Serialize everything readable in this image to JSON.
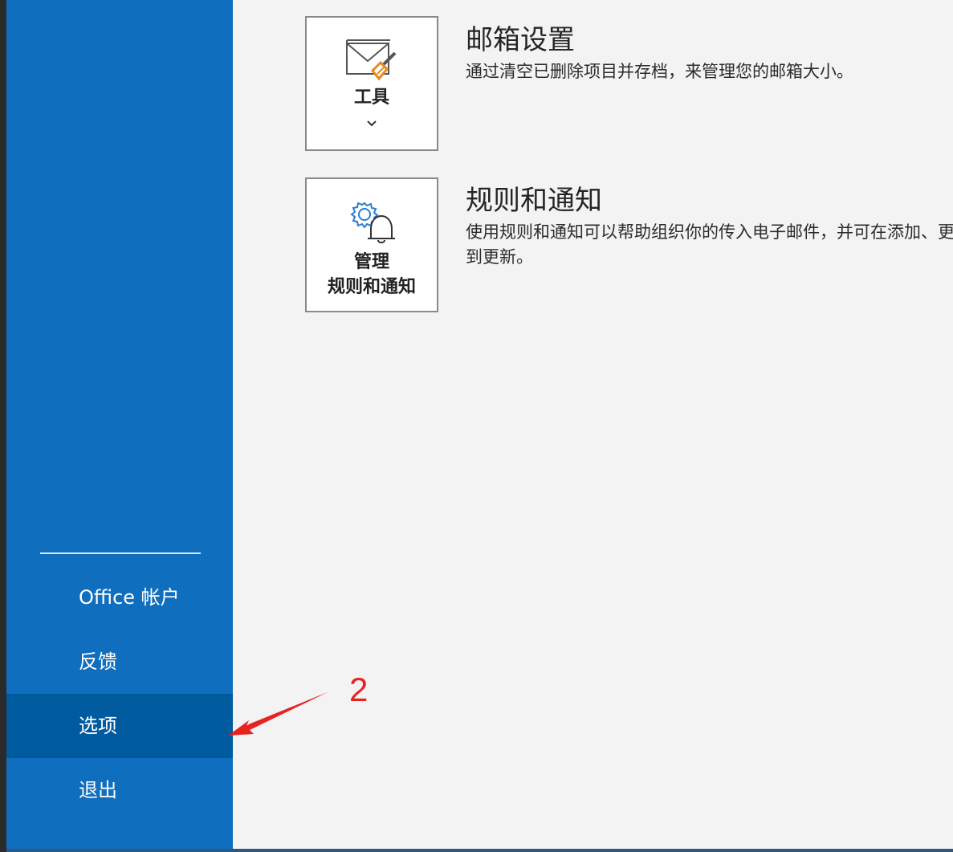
{
  "sidebar": {
    "items": [
      {
        "label": "Office 帐户"
      },
      {
        "label": "反馈"
      },
      {
        "label": "选项"
      },
      {
        "label": "退出"
      }
    ],
    "selected_index": 2
  },
  "sections": [
    {
      "tile_label_lines": [
        "工具"
      ],
      "title": "邮箱设置",
      "description_lines": [
        "通过清空已删除项目并存档，来管理您的邮箱大小。"
      ],
      "icon": "mailbox-cleanup-icon"
    },
    {
      "tile_label_lines": [
        "管理",
        "规则和通知"
      ],
      "title": "规则和通知",
      "description_lines": [
        "使用规则和通知可以帮助组织你的传入电子邮件，并可在添加、更改或删除项目时收",
        "到更新。"
      ],
      "icon": "rules-alerts-icon"
    }
  ],
  "annotation": {
    "number": "2",
    "color": "#e8231f"
  },
  "colors": {
    "sidebar": "#106ebe",
    "sidebar_selected": "#005a9e",
    "main_bg": "#f3f3f3",
    "accent_orange": "#e8891a",
    "icon_blue": "#2b7cd3"
  }
}
